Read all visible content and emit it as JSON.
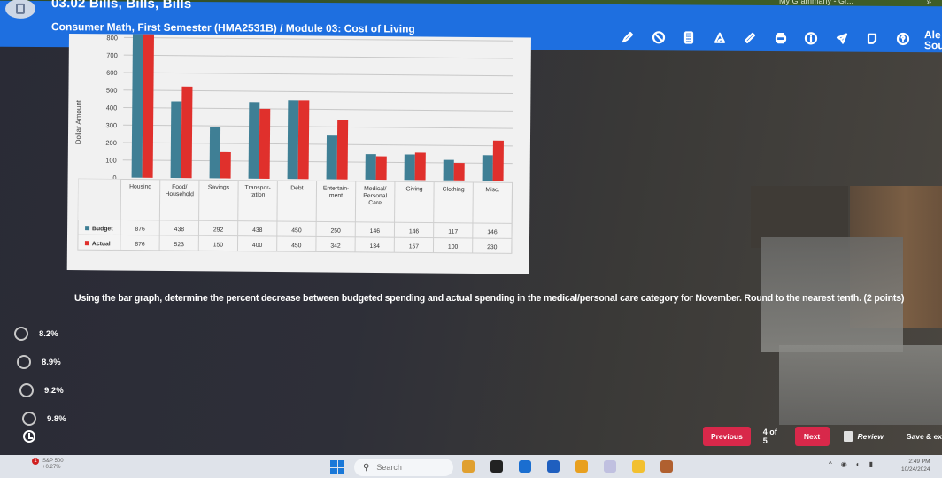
{
  "browser": {
    "extension_label": "My Grammarly - Gr...",
    "overflow_icon": "chevron-double-right-icon"
  },
  "header": {
    "title": "03.02 Bills, Bills, Bills",
    "subtitle": "Consumer Math, First Semester (HMA2531B) / Module 03: Cost of Living",
    "user_line1": "Ale",
    "user_line2": "Sou",
    "colors": {
      "header_bg": "#1e6fe0"
    },
    "tools": [
      {
        "name": "highlighter-icon",
        "label": "Highlighter"
      },
      {
        "name": "block-icon",
        "label": "Line reader"
      },
      {
        "name": "calculator-icon",
        "label": "Calculator"
      },
      {
        "name": "protractor-icon",
        "label": "Protractor"
      },
      {
        "name": "ruler-icon",
        "label": "Ruler"
      },
      {
        "name": "print-icon",
        "label": "Print"
      },
      {
        "name": "info-icon",
        "label": "Info"
      },
      {
        "name": "send-icon",
        "label": "Send"
      },
      {
        "name": "note-icon",
        "label": "Notes"
      },
      {
        "name": "help-icon",
        "label": "Help"
      }
    ]
  },
  "chart_data": {
    "type": "bar",
    "title": "",
    "xlabel": "",
    "ylabel": "Dollar Amount",
    "ylim": [
      0,
      850
    ],
    "yticks": [
      0,
      100,
      200,
      300,
      400,
      500,
      600,
      700,
      800
    ],
    "grid": true,
    "categories": [
      [
        "Housing"
      ],
      [
        "Food/",
        "Household"
      ],
      [
        "Savings"
      ],
      [
        "Transpor-",
        "tation"
      ],
      [
        "Debt"
      ],
      [
        "Entertain-",
        "ment"
      ],
      [
        "Medical/",
        "Personal",
        "Care"
      ],
      [
        "Giving"
      ],
      [
        "Clothing"
      ],
      [
        "Misc."
      ]
    ],
    "series": [
      {
        "name": "Budget",
        "color": "#3f7f95",
        "values": [
          876,
          438,
          292,
          438,
          450,
          250,
          146,
          146,
          117,
          146
        ]
      },
      {
        "name": "Actual",
        "color": "#e0302c",
        "values": [
          876,
          523,
          150,
          400,
          450,
          342,
          134,
          157,
          100,
          230
        ]
      }
    ],
    "legend": "data-table"
  },
  "question": {
    "text": "Using the bar graph, determine the percent decrease between budgeted spending and actual spending in the medical/personal care category for November. Round to the nearest tenth. (2 points)",
    "options": [
      "8.2%",
      "8.9%",
      "9.2%",
      "9.8%"
    ],
    "selected": null
  },
  "nav": {
    "previous": "Previous",
    "page_indicator": "4 of 5",
    "next": "Next",
    "review": "Review",
    "save_exit": "Save & ex",
    "accent": "#d8284a"
  },
  "taskbar": {
    "stock_name": "S&P 500",
    "stock_change": "+0.27%",
    "stock_badge": "1",
    "search_placeholder": "Search",
    "time": "2:49 PM",
    "date": "10/24/2024",
    "apps": [
      {
        "name": "widget-icon",
        "color": "#e0a030"
      },
      {
        "name": "terminal-icon",
        "color": "#222222"
      },
      {
        "name": "outlook-icon",
        "color": "#1a6ed0"
      },
      {
        "name": "word-icon",
        "color": "#1f5fbf"
      },
      {
        "name": "chrome-icon",
        "color": "#e8a020"
      },
      {
        "name": "snipping-tool-icon",
        "color": "#c0c0e0"
      },
      {
        "name": "file-explorer-icon",
        "color": "#f2c030"
      },
      {
        "name": "chrome-profile-icon",
        "color": "#b06030"
      }
    ]
  }
}
